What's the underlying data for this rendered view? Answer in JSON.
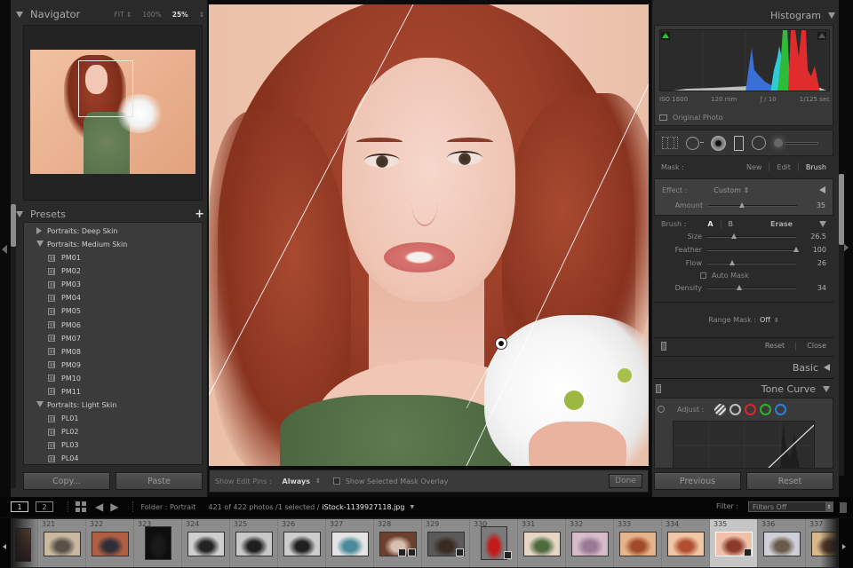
{
  "navigator": {
    "title": "Navigator",
    "zoom_options": [
      "FIT",
      "100%",
      "25%"
    ],
    "active_zoom": "25%"
  },
  "presets": {
    "title": "Presets",
    "groups": [
      {
        "label": "Portraits: Deep Skin",
        "expanded": false,
        "items": []
      },
      {
        "label": "Portraits: Medium Skin",
        "expanded": true,
        "items": [
          "PM01",
          "PM02",
          "PM03",
          "PM04",
          "PM05",
          "PM06",
          "PM07",
          "PM08",
          "PM09",
          "PM10",
          "PM11"
        ]
      },
      {
        "label": "Portraits: Light Skin",
        "expanded": true,
        "items": [
          "PL01",
          "PL02",
          "PL03",
          "PL04"
        ]
      }
    ]
  },
  "left_buttons": {
    "copy": "Copy...",
    "paste": "Paste"
  },
  "toolbar": {
    "show_edit_pins_label": "Show Edit Pins :",
    "show_edit_pins_value": "Always",
    "mask_overlay_label": "Show Selected Mask Overlay",
    "mask_overlay_checked": false,
    "done": "Done"
  },
  "histogram": {
    "title": "Histogram",
    "iso": "ISO 1600",
    "focal": "120 mm",
    "aperture": "ƒ / 10",
    "shutter": "1/125 sec",
    "original_photo_label": "Original Photo",
    "shadow_clip_color": "#25c12a"
  },
  "mask": {
    "label": "Mask :",
    "options": [
      "New",
      "Edit",
      "Brush"
    ],
    "active": "Brush"
  },
  "effect": {
    "label": "Effect :",
    "value": "Custom",
    "amount_label": "Amount",
    "amount": "35",
    "amount_fraction": 0.38
  },
  "brush": {
    "label": "Brush :",
    "a": "A",
    "b": "B",
    "erase": "Erase",
    "sliders": [
      {
        "label": "Size",
        "value": "26.5",
        "fraction": 0.3
      },
      {
        "label": "Feather",
        "value": "100",
        "fraction": 1.0
      },
      {
        "label": "Flow",
        "value": "26",
        "fraction": 0.28
      }
    ],
    "auto_mask_label": "Auto Mask",
    "auto_mask_checked": false,
    "density": {
      "label": "Density",
      "value": "34",
      "fraction": 0.36
    }
  },
  "range_mask": {
    "label": "Range Mask :",
    "value": "Off"
  },
  "panel_actions": {
    "reset": "Reset",
    "close": "Close"
  },
  "basic": {
    "title": "Basic"
  },
  "tone_curve": {
    "title": "Tone Curve",
    "adjust_label": "Adjust :",
    "channel_colors": {
      "rgb": "#bdbdbd",
      "red": "#e0242c",
      "green": "#2cb52c",
      "blue": "#2b7ee0"
    }
  },
  "right_buttons": {
    "previous": "Previous",
    "reset": "Reset"
  },
  "bottom_bar": {
    "screen1": "1",
    "screen2": "2",
    "folder": "Folder : Portrait",
    "count": "421 of 422 photos /1 selected /",
    "filename": "iStock-1139927118.jpg",
    "filter_label": "Filter :",
    "filter_value": "Filters Off"
  },
  "filmstrip": {
    "cells": [
      {
        "num": "321",
        "colors": [
          "#c9b9a0",
          "#5a5048"
        ],
        "badges": []
      },
      {
        "num": "322",
        "colors": [
          "#b15f42",
          "#2e2f38"
        ],
        "badges": []
      },
      {
        "num": "323",
        "colors": [
          "#0e0e0e",
          "#1a1a1a"
        ],
        "badges": [],
        "tall": true
      },
      {
        "num": "324",
        "colors": [
          "#cfcfcf",
          "#222"
        ],
        "badges": []
      },
      {
        "num": "325",
        "colors": [
          "#c8c8c8",
          "#1e1e1e"
        ],
        "badges": []
      },
      {
        "num": "326",
        "colors": [
          "#cdcdcd",
          "#202020"
        ],
        "badges": []
      },
      {
        "num": "327",
        "colors": [
          "#e4e4e4",
          "#4a8a9a"
        ],
        "badges": []
      },
      {
        "num": "328",
        "colors": [
          "#6c4030",
          "#d8c0b0"
        ],
        "badges": [
          "copy",
          "edit"
        ]
      },
      {
        "num": "329",
        "colors": [
          "#5a5a5a",
          "#3a2a22"
        ],
        "badges": [
          "copy"
        ]
      },
      {
        "num": "330",
        "colors": [
          "#7a7a7a",
          "#c41a1a"
        ],
        "badges": [
          "copy"
        ],
        "tall": true
      },
      {
        "num": "331",
        "colors": [
          "#e7d6c6",
          "#4e6b3e"
        ],
        "badges": []
      },
      {
        "num": "332",
        "colors": [
          "#d4bcc8",
          "#9a7898"
        ],
        "badges": []
      },
      {
        "num": "333",
        "colors": [
          "#e6b48c",
          "#a04a2a"
        ],
        "badges": []
      },
      {
        "num": "334",
        "colors": [
          "#f0c8a8",
          "#b05030"
        ],
        "badges": []
      },
      {
        "num": "335",
        "colors": [
          "#f0c0a8",
          "#8a3a2a"
        ],
        "badges": [
          "edit"
        ],
        "selected": true
      },
      {
        "num": "336",
        "colors": [
          "#cfcfd8",
          "#6a5a4a"
        ],
        "badges": []
      },
      {
        "num": "337",
        "colors": [
          "#d8b888",
          "#5a3a2a"
        ],
        "badges": []
      }
    ]
  }
}
